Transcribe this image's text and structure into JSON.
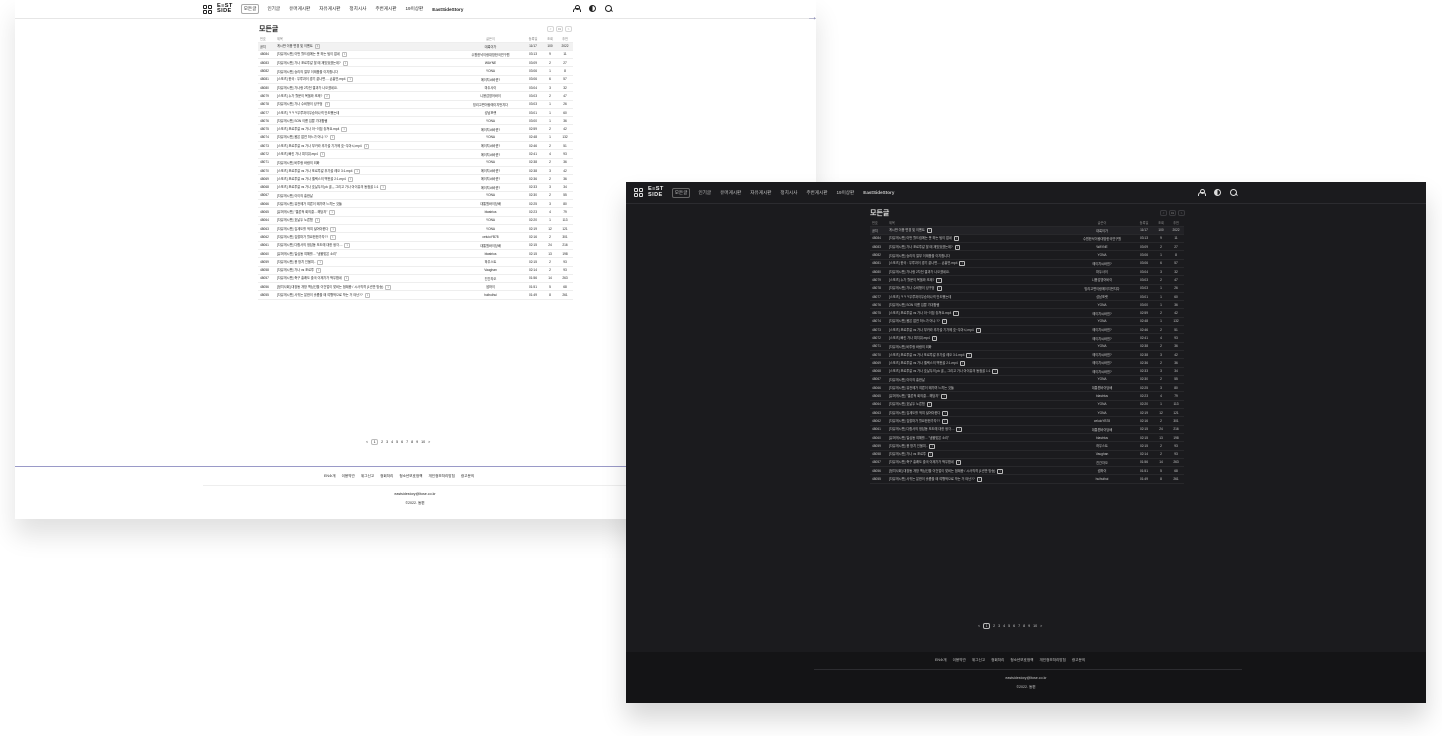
{
  "nav": {
    "logo_top": "E≡ST",
    "logo_bottom": "SIDE",
    "menu": [
      "모든글",
      "인기글",
      "유머게시판",
      "자유게시판",
      "정치시사",
      "주번게시판",
      "19이상판",
      "EastSideStory"
    ]
  },
  "board": {
    "title": "모든글",
    "pager_top": [
      "<",
      "01",
      ">"
    ],
    "headers": {
      "num": "번호",
      "title": "제목",
      "author": "글쓴이",
      "date": "등록일",
      "views": "조회",
      "likes": "추천"
    },
    "notice": {
      "num": "공지",
      "title": "게시판 이용 변경 및 이벤트",
      "comments": "4",
      "author": "대륙이가",
      "date": "11/17",
      "views": "100",
      "likes": "2022"
    },
    "rows": [
      {
        "num": "48084",
        "cat": "[자유게시판]",
        "title": "이번 월드컵에는 못 하는 팀이 없네",
        "comments": "1",
        "author": "수원한낙이랑대방한국연구원",
        "date": "03:13",
        "views": "9",
        "likes": "11"
      },
      {
        "num": "48083",
        "cat": "[자유게시판]",
        "title": "가나 포르투갈 할 때 재밌었겠는데?",
        "comments": "1",
        "author": "WAYNE",
        "date": "03:09",
        "views": "2",
        "likes": "27"
      },
      {
        "num": "48082",
        "cat": "[자유게시판]",
        "title": "승리의 절부 이제품을 이지합니다",
        "comments": "",
        "author": "YONA",
        "date": "03:06",
        "views": "1",
        "likes": "8"
      },
      {
        "num": "48081",
        "cat": "[스포츠]",
        "title": "한국 : 우루과이 경기 끝나면.... 손흥민.mp4",
        "comments": "1",
        "author": "에이치씨바뀐?",
        "date": "03:06",
        "views": "6",
        "likes": "57"
      },
      {
        "num": "48080",
        "cat": "[자유게시판]",
        "title": "가나랑 2차전 결과가 나오겠네요.",
        "comments": "",
        "author": "마두사이",
        "date": "03:04",
        "views": "3",
        "likes": "32"
      },
      {
        "num": "48079",
        "cat": "[스포츠]",
        "title": "누가 월문이 목을와 조제?",
        "comments": "2",
        "author": "니용감영어바이",
        "date": "03:03",
        "views": "2",
        "likes": "47"
      },
      {
        "num": "48078",
        "cat": "[자유게시판]",
        "title": "가나 수비형이 성구멍",
        "comments": "3",
        "author": "빙리고편이랑에이지먼지다",
        "date": "03:03",
        "views": "1",
        "likes": "26"
      },
      {
        "num": "48077",
        "cat": "[스포츠]",
        "title": "ㅋㅋㅋ우루과이우승하나넥 안도쨌는데",
        "comments": "",
        "author": "성남포랫",
        "date": "03:01",
        "views": "1",
        "likes": "60"
      },
      {
        "num": "48076",
        "cat": "[자유게시판]",
        "title": "SON 이름 입뿐 기대합쌤",
        "comments": "",
        "author": "YONA",
        "date": "03:00",
        "views": "1",
        "likes": "36"
      },
      {
        "num": "48075",
        "cat": "[스포츠]",
        "title": "포르투갈 vs 가나 아~이짐 놓쳐요.mp4",
        "comments": "1",
        "author": "에이치씨바뀐?",
        "date": "02:59",
        "views": "2",
        "likes": "42"
      },
      {
        "num": "48074",
        "cat": "[자유게시판]",
        "title": "몸은 없연 하느가 어냐 ??",
        "comments": "1",
        "author": "YONA",
        "date": "02:48",
        "views": "1",
        "likes": "132"
      },
      {
        "num": "48073",
        "cat": "[스포츠]",
        "title": "포르투갈 vs 가나 부카라 추가골 기가에 호~우아시.mp4",
        "comments": "1",
        "author": "에이치씨바뀐?",
        "date": "02:46",
        "views": "2",
        "likes": "51"
      },
      {
        "num": "48072",
        "cat": "[스포츠]",
        "title": "빠킨 가나 피지워.mp4",
        "comments": "1",
        "author": "에이치씨바뀐?",
        "date": "02:41",
        "views": "4",
        "likes": "93"
      },
      {
        "num": "48071",
        "cat": "[자유게시판]",
        "title": "바투랑 바람의 외화",
        "comments": "",
        "author": "YONA",
        "date": "02:38",
        "views": "2",
        "likes": "36"
      },
      {
        "num": "48070",
        "cat": "[스포츠]",
        "title": "포르투갈 vs 가나 포르투갈 추가골 레오 3:1.mp4",
        "comments": "1",
        "author": "에이치씨바뀐?",
        "date": "02:38",
        "views": "3",
        "likes": "42"
      },
      {
        "num": "48069",
        "cat": "[스포츠]",
        "title": "포르투갈 vs 가나 벨렉스의 맥헌골 2:1.mp4",
        "comments": "1",
        "author": "에이치씨바뀐?",
        "date": "02:36",
        "views": "2",
        "likes": "36"
      },
      {
        "num": "48068",
        "cat": "[스포츠]",
        "title": "포르투갈 vs 가나 호날두의 pk 골,,, 그리고 가나 아이유의 동점골 1:1",
        "comments": "1",
        "author": "에이치씨바뀐?",
        "date": "02:33",
        "views": "3",
        "likes": "34"
      },
      {
        "num": "48067",
        "cat": "[자유게시판]",
        "title": "이이의 흥한날",
        "comments": "",
        "author": "YONA",
        "date": "02:30",
        "views": "2",
        "likes": "55"
      },
      {
        "num": "48066",
        "cat": "[자유게시판]",
        "title": "뮤전에가 여른이 돼가며 느끼는 것들",
        "comments": "",
        "author": "대통원바이당배",
        "date": "02:25",
        "views": "3",
        "likes": "80"
      },
      {
        "num": "48065",
        "cat": "[유머게시판]",
        "title": "\"결론적 회의결... 해당자\"",
        "comments": "1",
        "author": "blastrius",
        "date": "02:23",
        "views": "4",
        "likes": "79"
      },
      {
        "num": "48064",
        "cat": "[자유게시판]",
        "title": "호날두 노른협",
        "comments": "1",
        "author": "YONA",
        "date": "02:20",
        "views": "1",
        "likes": "113"
      },
      {
        "num": "48063",
        "cat": "[자유게시판]",
        "title": "김계도를 적여 설어야한다",
        "comments": "1",
        "author": "YONA",
        "date": "02:19",
        "views": "12",
        "likes": "121"
      },
      {
        "num": "48062",
        "cat": "[자유게시판]",
        "title": "김할마가 월요한한가자??",
        "comments": "1",
        "author": "celuioYB78",
        "date": "02:16",
        "views": "2",
        "likes": "301"
      },
      {
        "num": "48061",
        "cat": "[자유게시판]",
        "title": "다합사의 정답동 보도에 대한 생각....",
        "comments": "1",
        "author": "대통원바이당배",
        "date": "02:15",
        "views": "24",
        "likes": "216"
      },
      {
        "num": "48060",
        "cat": "[유머게시판]",
        "title": "일심동 여해를... \"냉불맞은 소리\"",
        "comments": "",
        "author": "blastrius",
        "date": "02:15",
        "views": "13",
        "likes": "198"
      },
      {
        "num": "48059",
        "cat": "[자유게시판]",
        "title": "용 방치 인물여..",
        "comments": "1",
        "author": "하우스트",
        "date": "02:15",
        "views": "2",
        "likes": "93"
      },
      {
        "num": "48058",
        "cat": "[자유게시판]",
        "title": "가나 vs 포르투",
        "comments": "1",
        "author": "Vaughan",
        "date": "02:14",
        "views": "2",
        "likes": "93"
      },
      {
        "num": "48057",
        "cat": "[자유게시판]",
        "title": "축구 흥쾌도 출국 이제가가 떡우합네",
        "comments": "1",
        "author": "진간자오",
        "date": "01:56",
        "views": "14",
        "likes": "263"
      },
      {
        "num": "48056",
        "cat": "[정치사회]",
        "title": "대장동 개방 맥심선을 이건업이 맞비는 범례증 / 시사직격 (1년만 방송)",
        "comments": "1",
        "author": "썸하이",
        "date": "01:51",
        "views": "5",
        "likes": "68"
      },
      {
        "num": "48055",
        "cat": "[자유게시판]",
        "title": "사귀는 분한이 흘릅을 때 여행적으로 막는 거 야난??",
        "comments": "1",
        "author": "huihuihui",
        "date": "01:49",
        "views": "8",
        "likes": "261"
      }
    ],
    "pages": [
      "<",
      "1",
      "2",
      "3",
      "4",
      "5",
      "6",
      "7",
      "8",
      "9",
      "10",
      ">"
    ]
  },
  "footer": {
    "links": [
      "EN소개",
      "이용약관",
      "위그신고",
      "정회처리",
      "청소년보호정책",
      "개인정보처리방침",
      "광고문의"
    ],
    "email": "eastsidestory@ltose.co.kr",
    "copyright": "©2022. 동편"
  }
}
